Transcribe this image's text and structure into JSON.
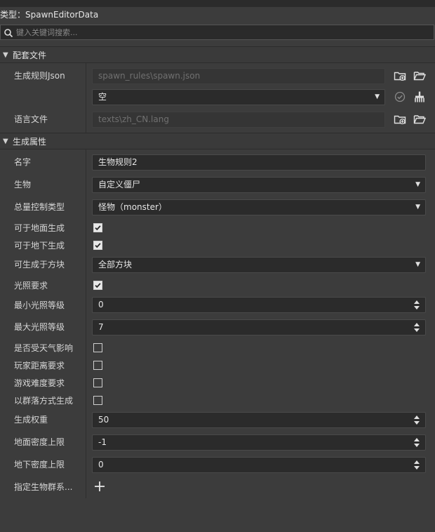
{
  "header": {
    "title": "类型：SpawnEditorData"
  },
  "search": {
    "placeholder": "键入关键词搜索..."
  },
  "sections": {
    "files": {
      "label": "配套文件"
    },
    "props": {
      "label": "生成属性"
    }
  },
  "files": {
    "spawn_rules_label": "生成规则Json",
    "spawn_rules_value": "spawn_rules\\spawn.json",
    "spawn_rules_select": "空",
    "lang_label": "语言文件",
    "lang_value": "texts\\zh_CN.lang"
  },
  "props": {
    "name_label": "名字",
    "name_value": "生物规则2",
    "entity_label": "生物",
    "entity_value": "自定义僵尸",
    "population_label": "总量控制类型",
    "population_value": "怪物（monster）",
    "surface_label": "可于地面生成",
    "surface_checked": true,
    "underground_label": "可于地下生成",
    "underground_checked": true,
    "blocks_label": "可生成于方块",
    "blocks_value": "全部方块",
    "light_label": "光照要求",
    "light_checked": true,
    "min_light_label": "最小光照等级",
    "min_light_value": "0",
    "max_light_label": "最大光照等级",
    "max_light_value": "7",
    "weather_label": "是否受天气影响",
    "weather_checked": false,
    "player_dist_label": "玩家距离要求",
    "player_dist_checked": false,
    "difficulty_label": "游戏难度要求",
    "difficulty_checked": false,
    "herd_label": "以群落方式生成",
    "herd_checked": false,
    "weight_label": "生成权重",
    "weight_value": "50",
    "surface_density_label": "地面密度上限",
    "surface_density_value": "-1",
    "underground_density_label": "地下密度上限",
    "underground_density_value": "0",
    "biome_label": "指定生物群系..."
  },
  "icons": {
    "new_folder": "folder-plus-icon",
    "open_folder": "folder-open-icon",
    "check": "check-circle-icon",
    "clean": "broom-icon",
    "add": "plus-icon"
  }
}
